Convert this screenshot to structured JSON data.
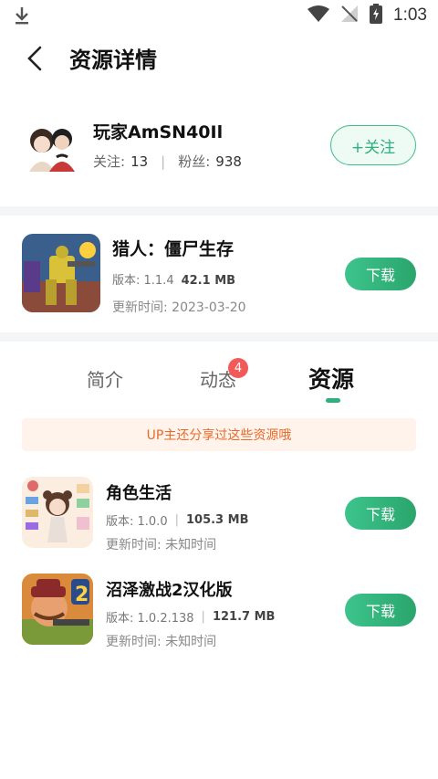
{
  "status_bar": {
    "time": "1:03"
  },
  "header": {
    "title": "资源详情"
  },
  "profile": {
    "name": "玩家AmSN40Il",
    "following_label": "关注:",
    "following_count": "13",
    "fans_label": "粉丝:",
    "fans_count": "938",
    "follow_button": "+关注"
  },
  "game": {
    "name": "猎人：僵尸生存",
    "version_label": "版本: 1.1.4",
    "size": "42.1 MB",
    "update": "更新时间: 2023-03-20",
    "download": "下载"
  },
  "tabs": [
    {
      "label": "简介"
    },
    {
      "label": "动态",
      "badge": "4"
    },
    {
      "label": "资源"
    }
  ],
  "notice": "UP主还分享过这些资源哦",
  "resources": [
    {
      "name": "角色生活",
      "version": "版本: 1.0.0",
      "size": "105.3 MB",
      "update": "更新时间: 未知时间",
      "download": "下载"
    },
    {
      "name": "沼泽激战2汉化版",
      "version": "版本: 1.0.2.138",
      "size": "121.7 MB",
      "update": "更新时间: 未知时间",
      "download": "下载"
    }
  ],
  "colors": {
    "accent": "#2fb07c",
    "notice_bg": "#fff3eb",
    "notice_text": "#e86a2a",
    "badge": "#f25a5a"
  }
}
